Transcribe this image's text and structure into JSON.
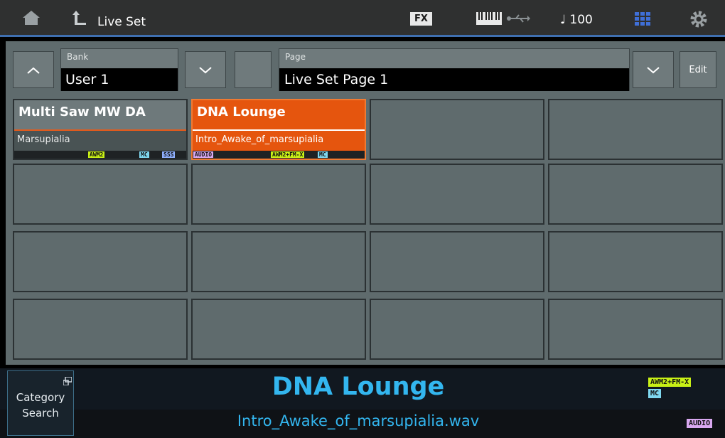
{
  "header": {
    "title": "Live Set",
    "fx_label": "FX",
    "tempo": "♩ 100"
  },
  "controls": {
    "bank_label": "Bank",
    "bank_value": "User 1",
    "page_label": "Page",
    "page_value": "Live Set Page  1",
    "edit_label": "Edit"
  },
  "slots": [
    {
      "name": "Multi Saw MW DA",
      "sub": "Marsupialia",
      "tags": [
        "AWM2",
        "MC",
        "SSS"
      ]
    },
    {
      "name": "DNA Lounge",
      "sub": "Intro_Awake_of_marsupialia",
      "tags": [
        "AUDIO",
        "AWM2+FM-X",
        "MC"
      ]
    }
  ],
  "bottom": {
    "category_search": "Category Search",
    "performance_name": "DNA Lounge",
    "file_name": "Intro_Awake_of_marsupialia.wav",
    "engine_tag": "AWM2+FM-X",
    "mc_tag": "MC",
    "audio_tag": "AUDIO"
  },
  "colors": {
    "accent": "#33b6ef",
    "active_slot": "#e5550e",
    "awm2": "#c8f016",
    "fmx": "#3fe8b0",
    "mc": "#7fd8f0",
    "sss": "#8fb0ff",
    "audio": "#d9a8f0"
  }
}
